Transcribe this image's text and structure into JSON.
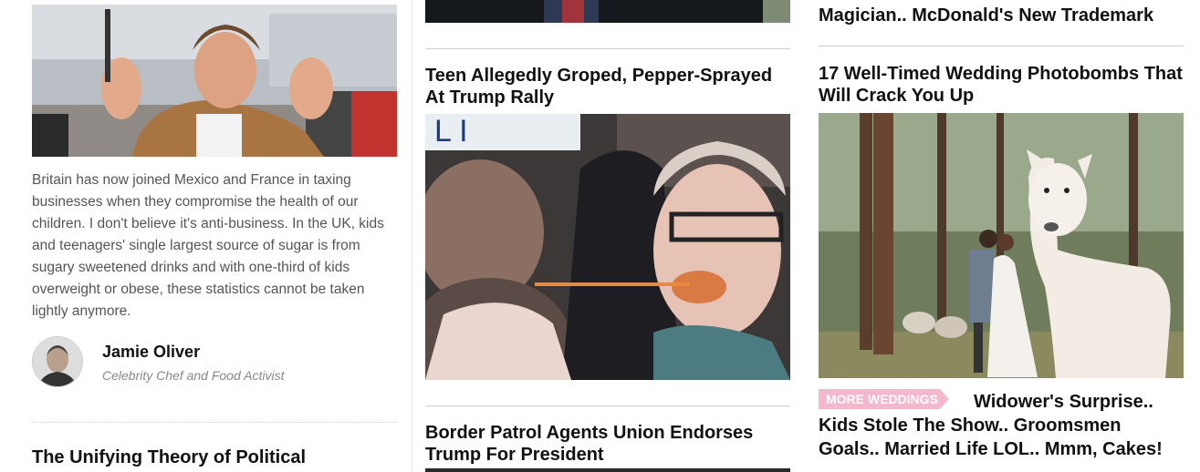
{
  "left_column": {
    "blurb": "Britain has now joined Mexico and France in taxing businesses when they compromise the health of our children. I don't believe it's anti-business. In the UK, kids and teenagers' single largest source of sugar is from sugary sweetened drinks and with one-third of kids overweight or obese, these statistics cannot be taken lightly anymore.",
    "author": {
      "name": "Jamie Oliver",
      "role": "Celebrity Chef and Food Activist"
    },
    "next_headline": "The Unifying Theory of Political"
  },
  "middle_column": {
    "articles": [
      {
        "headline": "Teen Allegedly Groped, Pepper-Sprayed At Trump Rally"
      },
      {
        "headline": "Border Patrol Agents Union Endorses Trump For President"
      }
    ]
  },
  "right_column": {
    "top_headline_tail": "Magician.. McDonald's New Trademark",
    "feature": {
      "headline": "17 Well-Timed Wedding Photobombs That Will Crack You Up",
      "badge": "MORE WEDDINGS",
      "teaser": "Widower's Surprise.. Kids Stole The Show.. Groomsmen Goals.. Married Life LOL.. Mmm, Cakes!"
    },
    "badge_color": "#f4b7cd"
  }
}
